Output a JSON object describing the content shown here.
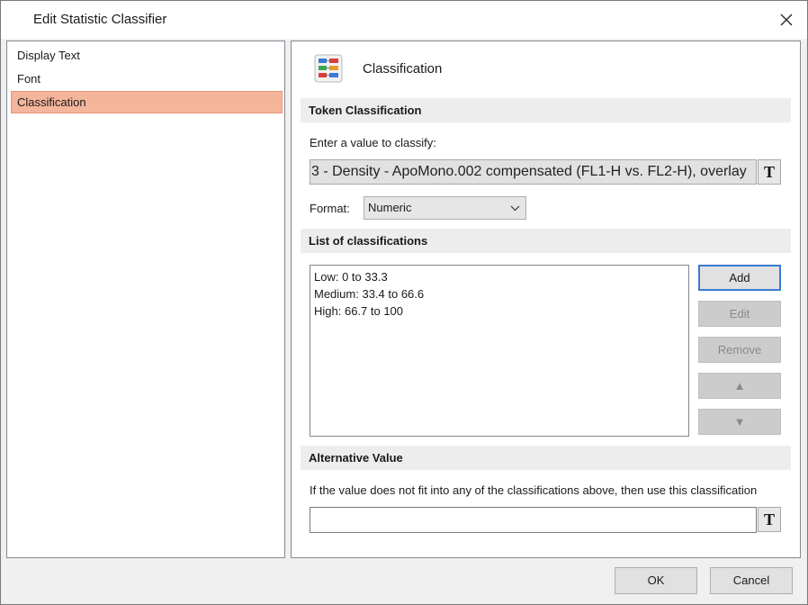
{
  "window": {
    "title": "Edit Statistic Classifier",
    "close_icon": "close-icon"
  },
  "nav": {
    "items": [
      {
        "label": "Display Text",
        "selected": false
      },
      {
        "label": "Font",
        "selected": false
      },
      {
        "label": "Classification",
        "selected": true
      }
    ],
    "selected_color": "#f4b59b"
  },
  "content": {
    "header": {
      "title": "Classification",
      "icon": "classification-icon"
    },
    "token_section": {
      "heading": "Token Classification",
      "prompt": "Enter a value to classify:",
      "value": "3 - Density - ApoMono.002 compensated (FL1-H vs. FL2-H), overlay",
      "token_button": "T",
      "format_label": "Format:",
      "format_value": "Numeric"
    },
    "list_section": {
      "heading": "List of classifications",
      "items": [
        "Low: 0 to 33.3",
        "Medium: 33.4 to 66.6",
        "High: 66.7 to 100"
      ],
      "buttons": {
        "add": "Add",
        "edit": "Edit",
        "remove": "Remove",
        "up": "▲",
        "down": "▼"
      }
    },
    "alt_section": {
      "heading": "Alternative Value",
      "description": "If the value does not fit into any of the classifications above, then use this classification",
      "value": "",
      "token_button": "T"
    }
  },
  "footer": {
    "ok": "OK",
    "cancel": "Cancel"
  },
  "colors": {
    "accent": "#3a7bd5",
    "section_bg": "#ededed",
    "window_bg": "#f0f0f0"
  }
}
